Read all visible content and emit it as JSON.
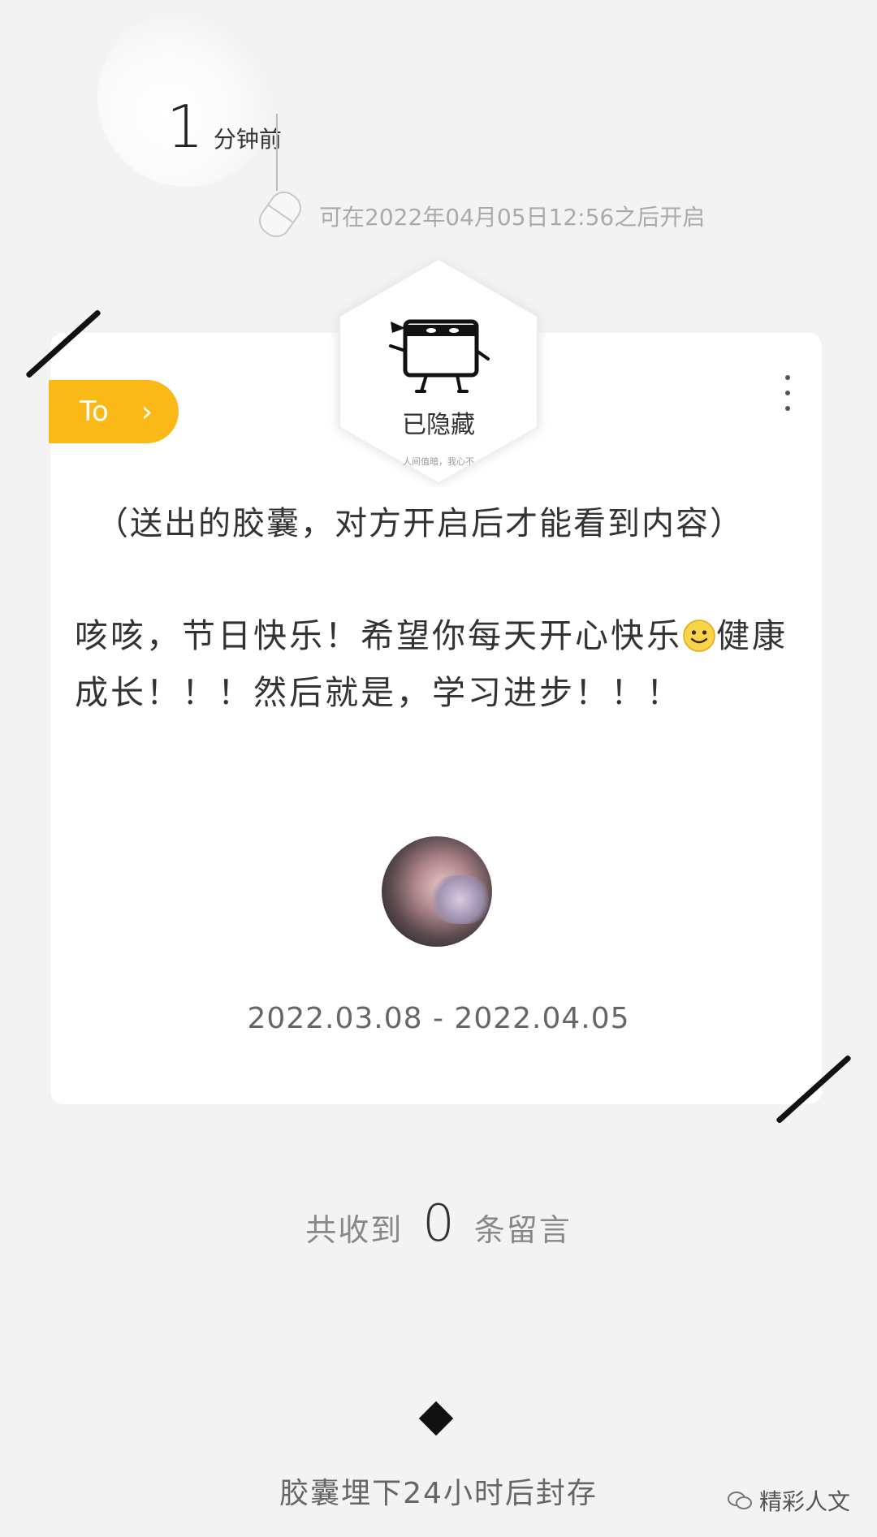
{
  "capsule": {
    "time_number": "1",
    "time_unit": "分钟前",
    "open_after": "可在2022年04月05日12:56之后开启",
    "recipient_tag": "To",
    "status_label": "已隐藏",
    "status_subtext": "人间值暗，我心不",
    "note": "（送出的胶囊，对方开启后才能看到内容）",
    "message_part1": "咳咳，节日快乐！希望你每天开心快乐",
    "message_emoji": "smiley-emoji",
    "message_part2": "健康成长！！！然后就是，学习进步！！！",
    "date_range": "2022.03.08 - 2022.04.05"
  },
  "comments": {
    "prefix": "共收到",
    "count": "0",
    "suffix": "条留言"
  },
  "footer": {
    "seal_note": "胶囊埋下24小时后封存"
  },
  "watermark": {
    "text": "精彩人文"
  },
  "colors": {
    "accent": "#fbb917",
    "background": "#f3f3f3",
    "card": "#ffffff"
  }
}
